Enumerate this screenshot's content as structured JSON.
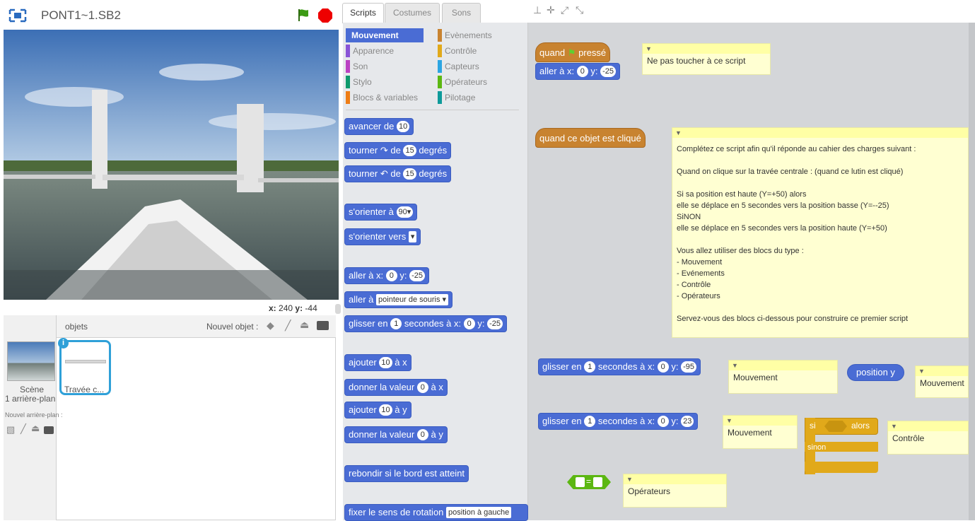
{
  "stage": {
    "title": "PONT1~1.SB2",
    "x_label": "x:",
    "x_value": "240",
    "y_label": "y:",
    "y_value": "-44"
  },
  "sprites": {
    "header_label": "objets",
    "new_sprite_label": "Nouvel objet :",
    "scene_label": "Scène",
    "scene_count": "1 arrière-plan",
    "new_backdrop_label": "Nouvel arrière-plan :",
    "sprite_name": "Travée c..."
  },
  "tabs": [
    "Scripts",
    "Costumes",
    "Sons"
  ],
  "categories": {
    "left": [
      "Mouvement",
      "Apparence",
      "Son",
      "Stylo",
      "Blocs & variables"
    ],
    "right": [
      "Evènements",
      "Contrôle",
      "Capteurs",
      "Opérateurs",
      "Pilotage"
    ],
    "colors_left": [
      "#4a6cd4",
      "#8a55d7",
      "#bb42c3",
      "#0e9a6c",
      "#ee7d16"
    ],
    "colors_right": [
      "#c88330",
      "#e1a91a",
      "#2ca5e2",
      "#5cb712",
      "#0e9a9a"
    ]
  },
  "palette": {
    "move": [
      "avancer de",
      "10"
    ],
    "turn_right": [
      "tourner",
      "de",
      "15",
      "degrés"
    ],
    "turn_left": [
      "tourner",
      "de",
      "15",
      "degrés"
    ],
    "point_dir": [
      "s'orienter à",
      "90▾"
    ],
    "point_towards": [
      "s'orienter vers",
      "▾"
    ],
    "goto_xy": [
      "aller à x:",
      "0",
      "y:",
      "-25"
    ],
    "goto": [
      "aller à",
      "pointeur de souris ▾"
    ],
    "glide": [
      "glisser en",
      "1",
      "secondes à x:",
      "0",
      "y:",
      "-25"
    ],
    "change_x": [
      "ajouter",
      "10",
      "à x"
    ],
    "set_x": [
      "donner la valeur",
      "0",
      "à x"
    ],
    "change_y": [
      "ajouter",
      "10",
      "à y"
    ],
    "set_y": [
      "donner la valeur",
      "0",
      "à y"
    ],
    "bounce": "rebondir si le bord est atteint",
    "rotation": [
      "fixer le sens de rotation",
      "position à gauche"
    ]
  },
  "scripts": {
    "hat1": [
      "quand",
      "pressé"
    ],
    "goto1": [
      "aller à x:",
      "0",
      "y:",
      "-25"
    ],
    "note1": "Ne pas toucher à ce script",
    "hat2": "quand ce objet est cliqué",
    "note2": "Complétez ce script afin qu'il réponde au cahier des charges suivant :\n\nQuand on clique sur la travée centrale : (quand ce lutin est cliqué)\n\nSi sa position est haute (Y=+50) alors\n    elle se déplace en 5 secondes vers la position basse (Y=--25)\nSiNON\n    elle se déplace en 5 secondes vers la position haute (Y=+50)\n\nVous allez utiliser des blocs du type :\n- Mouvement\n- Evénements\n- Contrôle\n- Opérateurs\n\nServez-vous des blocs ci-dessous pour construire ce premier script",
    "glide1": [
      "glisser en",
      "1",
      "secondes à x:",
      "0",
      "y:",
      "-95"
    ],
    "note3": "Mouvement",
    "posy": "position y",
    "note4": "Mouvement",
    "glide2": [
      "glisser en",
      "1",
      "secondes à x:",
      "0",
      "y:",
      "23"
    ],
    "note5": "Mouvement",
    "if_label": "si",
    "then_label": "alors",
    "else_label": "sinon",
    "note6": "Contrôle",
    "eq": "=",
    "note7": "Opérateurs"
  }
}
